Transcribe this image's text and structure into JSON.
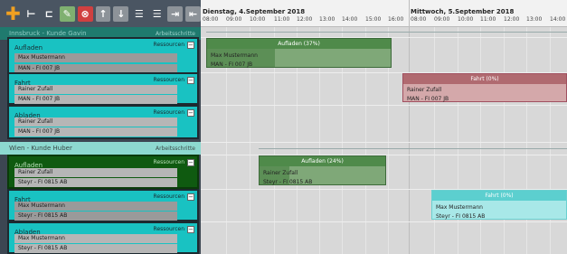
{
  "toolbar": {
    "icons": [
      "add-icon",
      "add-child-icon",
      "add-sub-icon",
      "edit-icon",
      "delete-icon",
      "move-up-icon",
      "move-down-icon",
      "expand-icon",
      "collapse-icon",
      "indent-icon",
      "outdent-icon"
    ]
  },
  "tree": {
    "groups": [
      {
        "name": "Innsbruck - Kunde Gavin",
        "tag": "Arbeitsschritte",
        "tasks": [
          {
            "name": "Aufladen",
            "res_label": "Ressourcen",
            "resources": [
              "Max Mustermann",
              "MAN - FI 007 JB"
            ]
          },
          {
            "name": "Fahrt",
            "res_label": "Ressourcen",
            "resources": [
              "Rainer Zufall",
              "MAN - FI 007 JB"
            ]
          },
          {
            "name": "Abladen",
            "res_label": "Ressourcen",
            "resources": [
              "Rainer Zufall",
              "MAN - FI 007 JB"
            ]
          }
        ]
      },
      {
        "name": "Wien - Kunde Huber",
        "tag": "Arbeitsschritte",
        "tasks": [
          {
            "name": "Aufladen",
            "res_label": "Ressourcen",
            "resources": [
              "Rainer Zufall",
              "Steyr - FI 0815 AB"
            ]
          },
          {
            "name": "Fahrt",
            "res_label": "Ressourcen",
            "resources": [
              "Max Mustermann",
              "Steyr - FI 0815 AB"
            ]
          },
          {
            "name": "Abladen",
            "res_label": "Ressourcen",
            "resources": [
              "Max Mustermann",
              "Steyr - FI 0815 AB"
            ]
          }
        ]
      }
    ],
    "expand_glyph": "−"
  },
  "timeline": {
    "days": [
      "Dienstag, 4.September 2018",
      "Mittwoch, 5.September 2018"
    ],
    "hours_day1": [
      "08:00",
      "09:00",
      "10:00",
      "11:00",
      "12:00",
      "13:00",
      "14:00",
      "15:00",
      "16:00"
    ],
    "hours_day2": [
      "08:00",
      "09:00",
      "10:00",
      "11:00",
      "12:00",
      "13:00",
      "14:00"
    ],
    "bars": [
      {
        "title": "Aufladen (37%)",
        "progress": 0.37,
        "lines": [
          "Max Mustermann",
          "MAN - FI 007 JB"
        ],
        "color": "#7fa878",
        "progress_color": "#3f7a3a",
        "title_color": "#4f8a4a"
      },
      {
        "title": "Fahrt (0%)",
        "progress": 0.0,
        "lines": [
          "Rainer Zufall",
          "MAN - FI 007 JB"
        ],
        "color": "#d4a8aa",
        "progress_color": "#b06a70",
        "title_color": "#b06a70"
      },
      {
        "title": "Aufladen (24%)",
        "progress": 0.24,
        "lines": [
          "Rainer Zufall",
          "Steyr - FI 0815 AB"
        ],
        "color": "#7fa878",
        "progress_color": "#3f7a3a",
        "title_color": "#4f8a4a"
      },
      {
        "title": "Fahrt (0%)",
        "progress": 0.0,
        "lines": [
          "Max Mustermann",
          "Steyr - FI 0815 AB"
        ],
        "color": "#a8e8e8",
        "progress_color": "#5ccfcf",
        "title_color": "#5ccfcf"
      }
    ]
  }
}
